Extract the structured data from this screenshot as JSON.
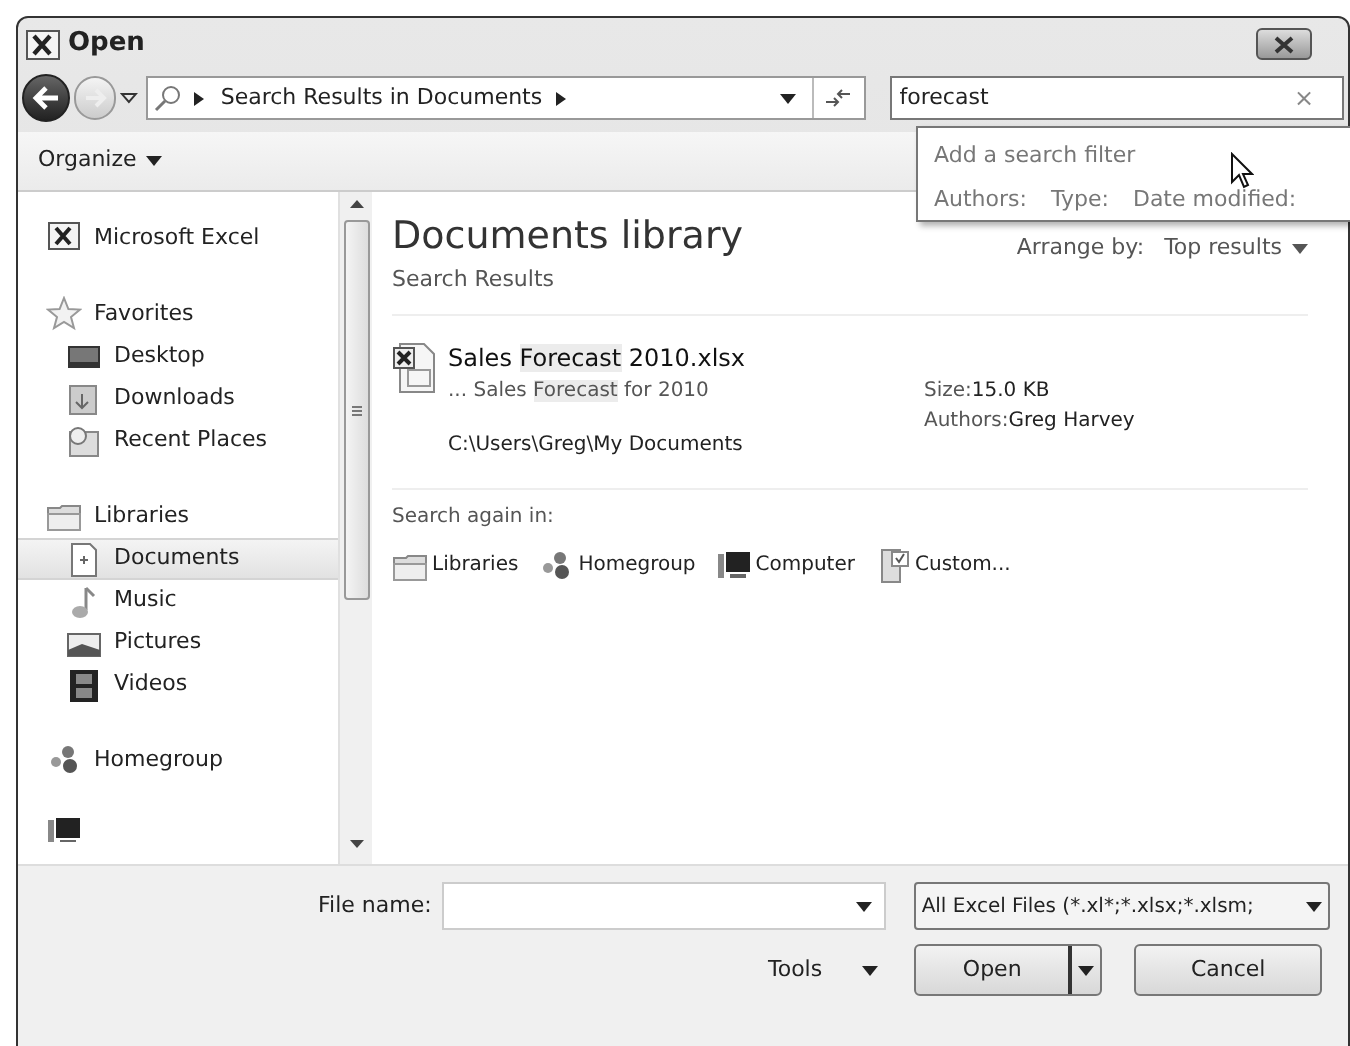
{
  "window": {
    "title": "Open"
  },
  "address_bar": {
    "path": "Search Results in Documents"
  },
  "search": {
    "value": "forecast",
    "clear": "×",
    "dropdown": {
      "title": "Add a search filter",
      "filters": [
        "Authors:",
        "Type:",
        "Date modified:"
      ]
    }
  },
  "toolbar": {
    "organize": "Organize"
  },
  "nav": [
    {
      "label": "Microsoft Excel",
      "kind": "excel",
      "selected": false
    },
    {
      "label": "Favorites",
      "kind": "star",
      "selected": false,
      "children": [
        {
          "label": "Desktop",
          "kind": "desktop",
          "selected": false
        },
        {
          "label": "Downloads",
          "kind": "downloads",
          "selected": false
        },
        {
          "label": "Recent Places",
          "kind": "recent",
          "selected": false
        }
      ]
    },
    {
      "label": "Libraries",
      "kind": "library",
      "selected": false,
      "children": [
        {
          "label": "Documents",
          "kind": "document",
          "selected": true
        },
        {
          "label": "Music",
          "kind": "music",
          "selected": false
        },
        {
          "label": "Pictures",
          "kind": "pictures",
          "selected": false
        },
        {
          "label": "Videos",
          "kind": "videos",
          "selected": false
        }
      ]
    },
    {
      "label": "Homegroup",
      "kind": "homegroup",
      "selected": false
    }
  ],
  "content": {
    "title": "Documents library",
    "subtitle": "Search Results",
    "arrange_label": "Arrange by:",
    "arrange_value": "Top results",
    "results": [
      {
        "name_parts": [
          {
            "text": "Sales ",
            "highlighted": false
          },
          {
            "text": "Forecast",
            "highlighted": true
          },
          {
            "text": " 2010.xlsx",
            "highlighted": false
          }
        ],
        "snippet_parts": [
          {
            "text": "... Sales ",
            "highlighted": false
          },
          {
            "text": "Forecast",
            "highlighted": true
          },
          {
            "text": " for 2010",
            "highlighted": false
          }
        ],
        "path": "C:\\Users\\Greg\\My Documents",
        "size_label": "Size:",
        "size": "15.0 KB",
        "authors_label": "Authors:",
        "authors": "Greg Harvey"
      }
    ],
    "search_again_label": "Search again in:",
    "search_again": [
      {
        "label": "Libraries",
        "kind": "library"
      },
      {
        "label": "Homegroup",
        "kind": "homegroup"
      },
      {
        "label": "Computer",
        "kind": "computer"
      },
      {
        "label": "Custom...",
        "kind": "custom"
      }
    ]
  },
  "footer": {
    "file_name_label": "File name:",
    "file_type": "All Excel Files (*.xl*;*.xlsx;*.xlsm;",
    "tools": "Tools",
    "open": "Open",
    "cancel": "Cancel"
  }
}
